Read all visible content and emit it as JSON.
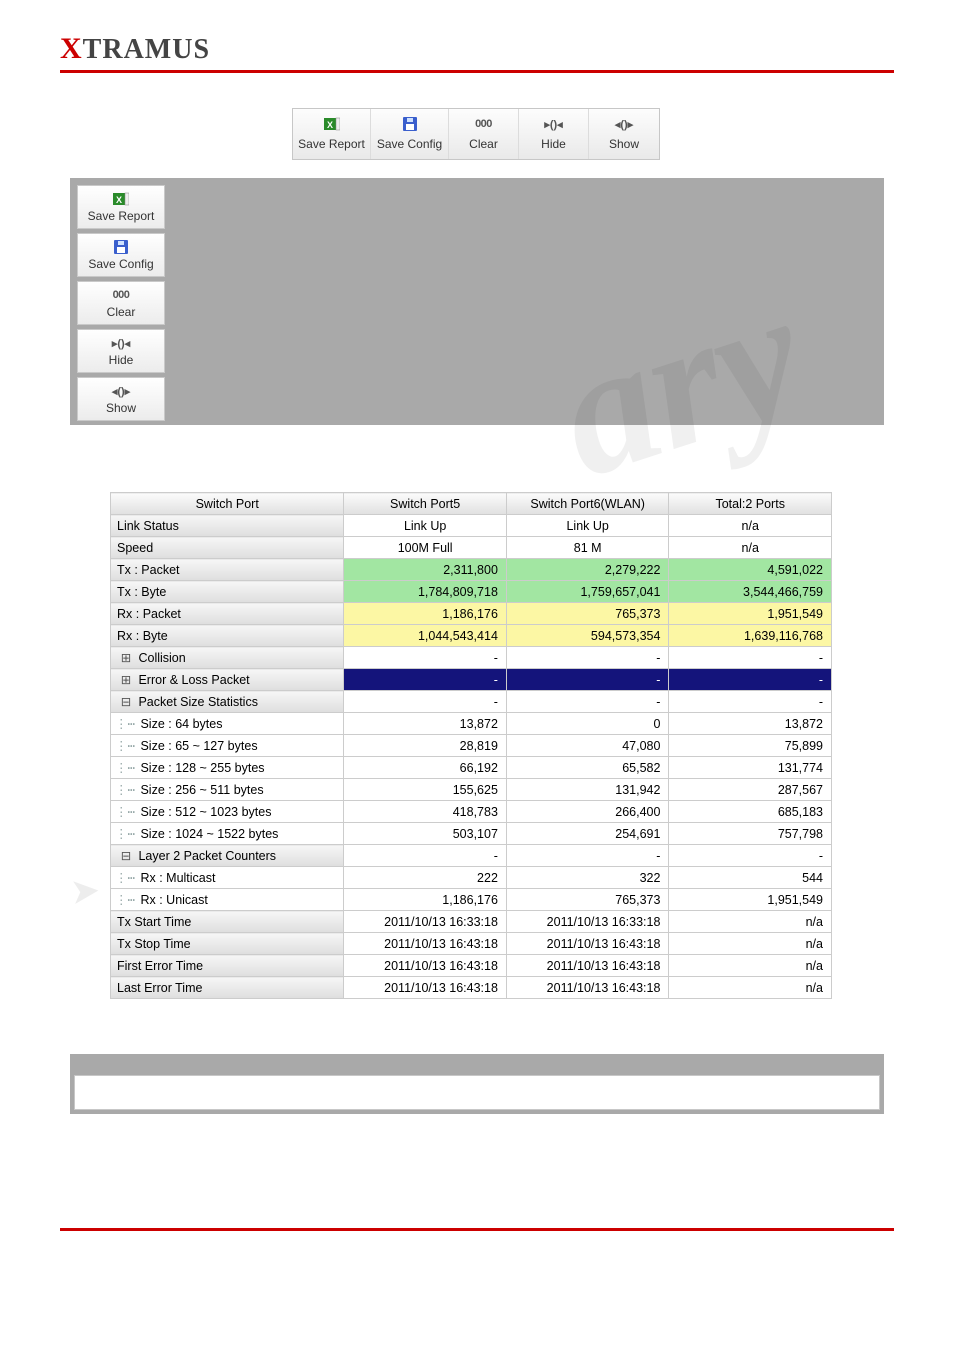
{
  "logo": {
    "x": "X",
    "rest": "TRAMUS"
  },
  "toolbar": [
    {
      "name": "save-report",
      "label": "Save Report",
      "icon": "excel"
    },
    {
      "name": "save-config",
      "label": "Save Config",
      "icon": "floppy"
    },
    {
      "name": "clear",
      "label": "Clear",
      "icon": "000"
    },
    {
      "name": "hide",
      "label": "Hide",
      "icon": "hide"
    },
    {
      "name": "show",
      "label": "Show",
      "icon": "show"
    }
  ],
  "sidebuttons": [
    {
      "name": "save-report",
      "label": "Save Report",
      "icon": "excel"
    },
    {
      "name": "save-config",
      "label": "Save Config",
      "icon": "floppy"
    },
    {
      "name": "clear",
      "label": "Clear",
      "icon": "000"
    },
    {
      "name": "hide",
      "label": "Hide",
      "icon": "hide"
    },
    {
      "name": "show",
      "label": "Show",
      "icon": "show"
    }
  ],
  "table": {
    "header": {
      "c0": "Switch Port",
      "c1": "Switch Port5",
      "c2": "Switch Port6(WLAN)",
      "c3": "Total:2 Ports"
    },
    "rows": [
      {
        "k": "sub",
        "c0": "Link Status",
        "c1": "Link Up",
        "c2": "Link Up",
        "c3": "n/a"
      },
      {
        "k": "sub",
        "c0": "Speed",
        "c1": "100M Full",
        "c2": "81 M",
        "c3": "n/a"
      },
      {
        "k": "tx",
        "c0": "Tx : Packet",
        "c1": "2,311,800",
        "c2": "2,279,222",
        "c3": "4,591,022",
        "num": true
      },
      {
        "k": "tx",
        "c0": "Tx : Byte",
        "c1": "1,784,809,718",
        "c2": "1,759,657,041",
        "c3": "3,544,466,759",
        "num": true
      },
      {
        "k": "rx",
        "c0": "Rx : Packet",
        "c1": "1,186,176",
        "c2": "765,373",
        "c3": "1,951,549",
        "num": true
      },
      {
        "k": "rx",
        "c0": "Rx : Byte",
        "c1": "1,044,543,414",
        "c2": "594,573,354",
        "c3": "1,639,116,768",
        "num": true
      },
      {
        "k": "sub",
        "tree": "⊞",
        "c0": "Collision",
        "c1": "-",
        "c2": "-",
        "c3": "-",
        "num": true
      },
      {
        "k": "err",
        "tree": "⊞",
        "c0": "Error & Loss Packet",
        "c1": "-",
        "c2": "-",
        "c3": "-",
        "num": true
      },
      {
        "k": "sub",
        "tree": "⊟",
        "c0": "Packet Size Statistics",
        "c1": "-",
        "c2": "-",
        "c3": "-",
        "num": true
      },
      {
        "k": "child",
        "c0": "Size : 64 bytes",
        "c1": "13,872",
        "c2": "0",
        "c3": "13,872",
        "num": true
      },
      {
        "k": "child",
        "c0": "Size : 65 ~ 127 bytes",
        "c1": "28,819",
        "c2": "47,080",
        "c3": "75,899",
        "num": true
      },
      {
        "k": "child",
        "c0": "Size : 128 ~ 255 bytes",
        "c1": "66,192",
        "c2": "65,582",
        "c3": "131,774",
        "num": true
      },
      {
        "k": "child",
        "c0": "Size : 256 ~ 511 bytes",
        "c1": "155,625",
        "c2": "131,942",
        "c3": "287,567",
        "num": true
      },
      {
        "k": "child",
        "c0": "Size : 512 ~ 1023 bytes",
        "c1": "418,783",
        "c2": "266,400",
        "c3": "685,183",
        "num": true
      },
      {
        "k": "child",
        "c0": "Size : 1024 ~ 1522 bytes",
        "c1": "503,107",
        "c2": "254,691",
        "c3": "757,798",
        "num": true
      },
      {
        "k": "sub",
        "tree": "⊟",
        "c0": "Layer 2 Packet Counters",
        "c1": "-",
        "c2": "-",
        "c3": "-",
        "num": true
      },
      {
        "k": "child",
        "c0": "Rx : Multicast",
        "c1": "222",
        "c2": "322",
        "c3": "544",
        "num": true
      },
      {
        "k": "child",
        "c0": "Rx : Unicast",
        "c1": "1,186,176",
        "c2": "765,373",
        "c3": "1,951,549",
        "num": true
      },
      {
        "k": "sub",
        "c0": "Tx Start Time",
        "c1": "2011/10/13 16:33:18",
        "c2": "2011/10/13 16:33:18",
        "c3": "n/a",
        "num": true
      },
      {
        "k": "sub",
        "c0": "Tx Stop Time",
        "c1": "2011/10/13 16:43:18",
        "c2": "2011/10/13 16:43:18",
        "c3": "n/a",
        "num": true
      },
      {
        "k": "sub",
        "c0": "First Error Time",
        "c1": "2011/10/13 16:43:18",
        "c2": "2011/10/13 16:43:18",
        "c3": "n/a",
        "num": true
      },
      {
        "k": "sub",
        "c0": "Last Error Time",
        "c1": "2011/10/13 16:43:18",
        "c2": "2011/10/13 16:43:18",
        "c3": "n/a",
        "num": true
      }
    ]
  },
  "chart_data": {
    "type": "table",
    "columns": [
      "Switch Port5",
      "Switch Port6(WLAN)",
      "Total:2 Ports"
    ],
    "rows": {
      "Link Status": [
        "Link Up",
        "Link Up",
        "n/a"
      ],
      "Speed": [
        "100M Full",
        "81 M",
        "n/a"
      ],
      "Tx : Packet": [
        2311800,
        2279222,
        4591022
      ],
      "Tx : Byte": [
        1784809718,
        1759657041,
        3544466759
      ],
      "Rx : Packet": [
        1186176,
        765373,
        1951549
      ],
      "Rx : Byte": [
        1044543414,
        594573354,
        1639116768
      ],
      "Size : 64 bytes": [
        13872,
        0,
        13872
      ],
      "Size : 65 ~ 127 bytes": [
        28819,
        47080,
        75899
      ],
      "Size : 128 ~ 255 bytes": [
        66192,
        65582,
        131774
      ],
      "Size : 256 ~ 511 bytes": [
        155625,
        131942,
        287567
      ],
      "Size : 512 ~ 1023 bytes": [
        418783,
        266400,
        685183
      ],
      "Size : 1024 ~ 1522 bytes": [
        503107,
        254691,
        757798
      ],
      "Rx : Multicast": [
        222,
        322,
        544
      ],
      "Rx : Unicast": [
        1186176,
        765373,
        1951549
      ],
      "Tx Start Time": [
        "2011/10/13 16:33:18",
        "2011/10/13 16:33:18",
        "n/a"
      ],
      "Tx Stop Time": [
        "2011/10/13 16:43:18",
        "2011/10/13 16:43:18",
        "n/a"
      ],
      "First Error Time": [
        "2011/10/13 16:43:18",
        "2011/10/13 16:43:18",
        "n/a"
      ],
      "Last Error Time": [
        "2011/10/13 16:43:18",
        "2011/10/13 16:43:18",
        "n/a"
      ]
    }
  }
}
